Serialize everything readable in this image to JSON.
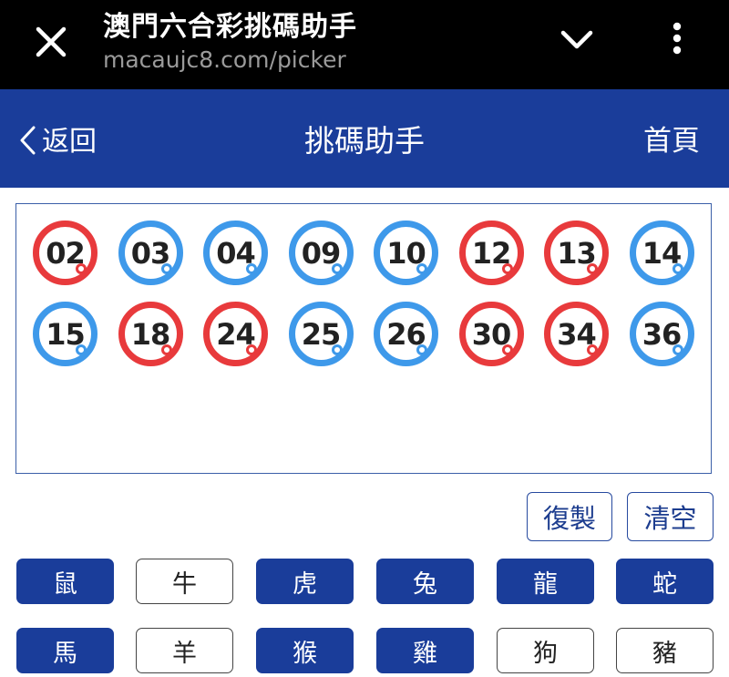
{
  "browser": {
    "title": "澳門六合彩挑碼助手",
    "url": "macaujc8.com/picker",
    "icons": [
      "close-icon",
      "chevron-down-icon",
      "more-vertical-icon"
    ]
  },
  "nav": {
    "back_label": "返回",
    "title": "挑碼助手",
    "home_label": "首頁"
  },
  "colors": {
    "nav_blue": "#1a3d9a",
    "ball_red": "#e83a3c",
    "ball_blue": "#3e99ea"
  },
  "balls": [
    {
      "number": "02",
      "color": "red"
    },
    {
      "number": "03",
      "color": "blue"
    },
    {
      "number": "04",
      "color": "blue"
    },
    {
      "number": "09",
      "color": "blue"
    },
    {
      "number": "10",
      "color": "blue"
    },
    {
      "number": "12",
      "color": "red"
    },
    {
      "number": "13",
      "color": "red"
    },
    {
      "number": "14",
      "color": "blue"
    },
    {
      "number": "15",
      "color": "blue"
    },
    {
      "number": "18",
      "color": "red"
    },
    {
      "number": "24",
      "color": "red"
    },
    {
      "number": "25",
      "color": "blue"
    },
    {
      "number": "26",
      "color": "blue"
    },
    {
      "number": "30",
      "color": "red"
    },
    {
      "number": "34",
      "color": "red"
    },
    {
      "number": "36",
      "color": "blue"
    }
  ],
  "actions": {
    "copy_label": "復製",
    "clear_label": "清空"
  },
  "zodiac": [
    {
      "label": "鼠",
      "selected": true
    },
    {
      "label": "牛",
      "selected": false
    },
    {
      "label": "虎",
      "selected": true
    },
    {
      "label": "兔",
      "selected": true
    },
    {
      "label": "龍",
      "selected": true
    },
    {
      "label": "蛇",
      "selected": true
    },
    {
      "label": "馬",
      "selected": true
    },
    {
      "label": "羊",
      "selected": false
    },
    {
      "label": "猴",
      "selected": true
    },
    {
      "label": "雞",
      "selected": true
    },
    {
      "label": "狗",
      "selected": false
    },
    {
      "label": "豬",
      "selected": false
    }
  ]
}
